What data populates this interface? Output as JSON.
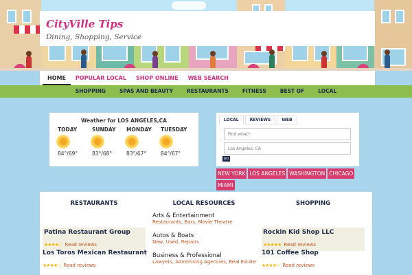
{
  "site": {
    "title": "CityVille Tips",
    "tagline": "Dining, Shopping, Service"
  },
  "nav_primary": [
    {
      "label": "HOME",
      "active": true
    },
    {
      "label": "POPULAR LOCAL"
    },
    {
      "label": "SHOP ONLINE"
    },
    {
      "label": "WEB SEARCH"
    }
  ],
  "nav_secondary": [
    "SHOPPING",
    "SPAS AND BEAUTY",
    "RESTAURANTS",
    "FITNESS",
    "BEST OF",
    "LOCAL"
  ],
  "weather": {
    "title": "Weather for LOS ANGELES,CA",
    "days": [
      {
        "day": "TODAY",
        "temp": "84°/69°",
        "icon": "sun-icon"
      },
      {
        "day": "SUNDAY",
        "temp": "83°/68°",
        "icon": "sun-icon"
      },
      {
        "day": "MONDAY",
        "temp": "83°/67°",
        "icon": "sun-icon"
      },
      {
        "day": "TUESDAY",
        "temp": "84°/67°",
        "icon": "sun-icon"
      }
    ]
  },
  "search": {
    "tabs": [
      "LOCAL",
      "REVIEWS",
      "WEB"
    ],
    "what_placeholder": "Find what?",
    "where_placeholder": "Los Angeles, CA",
    "go_label": "GO"
  },
  "cities": [
    "NEW YORK",
    "LOS ANGELES",
    "WASHINGTON",
    "CHICAGO",
    "MIAMI"
  ],
  "listings": {
    "restaurants_header": "RESTAURANTS",
    "local_header": "LOCAL RESOURCES",
    "shopping_header": "SHOPPING",
    "restaurants": [
      {
        "name": "Patina Restaurant Group",
        "stars": "★★★★☆",
        "link": "Read reviews"
      },
      {
        "name": "Los Toros Mexican Restaurant",
        "stars": "★★★★☆",
        "link": "Read reviews"
      }
    ],
    "categories": [
      {
        "name": "Arts & Entertainment",
        "sub": "Restaurants, Bars, Movie Theatre"
      },
      {
        "name": "Autos & Boats",
        "sub": "New, Used, Repairs"
      },
      {
        "name": "Business & Professional",
        "sub": "Lawyers, Advertising Agencies, Real Estate"
      }
    ],
    "shopping": [
      {
        "name": "Rockin Kid Shop LLC",
        "stars": "★★★★★",
        "link": "Read reviews"
      },
      {
        "name": "101 Coffee Shop",
        "stars": "★★★★☆",
        "link": "Read reviews"
      }
    ]
  },
  "colors": {
    "brand_pink": "#d02e7f",
    "nav_green": "#8cbd4e",
    "navy": "#1e2a4a",
    "link_orange": "#d0531e",
    "page_blue": "#a8d4ec"
  }
}
